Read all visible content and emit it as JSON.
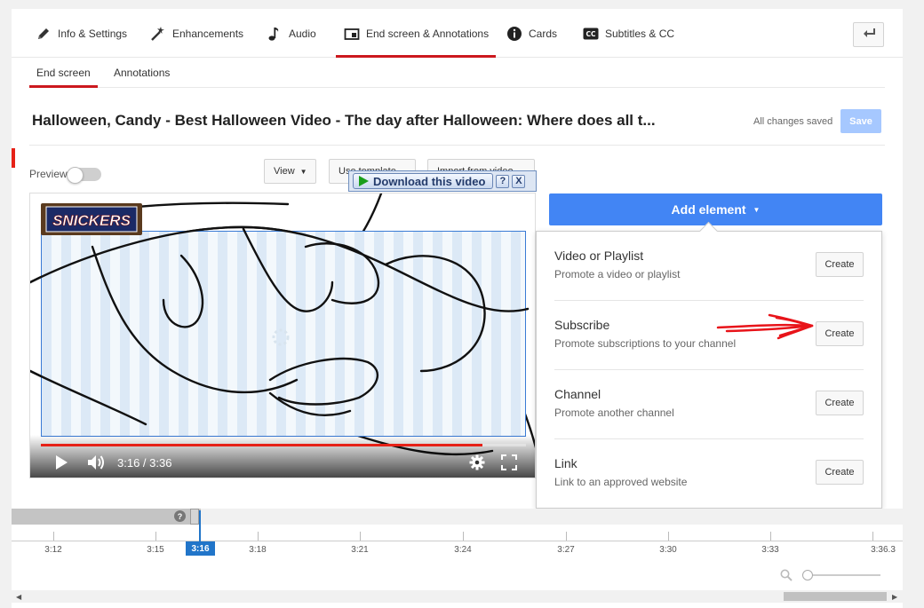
{
  "tabs": [
    {
      "label": "Info & Settings",
      "icon": "pencil-icon"
    },
    {
      "label": "Enhancements",
      "icon": "magic-wand-icon"
    },
    {
      "label": "Audio",
      "icon": "music-note-icon"
    },
    {
      "label": "End screen & Annotations",
      "icon": "end-screen-icon",
      "active": true
    },
    {
      "label": "Cards",
      "icon": "info-icon"
    },
    {
      "label": "Subtitles & CC",
      "icon": "cc-icon"
    }
  ],
  "subtabs": [
    {
      "label": "End screen",
      "active": true
    },
    {
      "label": "Annotations"
    }
  ],
  "header": {
    "title": "Halloween, Candy - Best Halloween Video - The day after Halloween: Where does all t...",
    "saved_status": "All changes saved",
    "save_label": "Save"
  },
  "toolbar": {
    "preview_label": "Preview",
    "view_label": "View",
    "use_template_label": "Use template",
    "import_label": "Import from video"
  },
  "overlay": {
    "download_label": "Download this video",
    "help": "?",
    "close": "X"
  },
  "video": {
    "logo_text": "SNICKERS",
    "current_time": "3:16",
    "duration": "3:36",
    "time_display": "3:16 / 3:36",
    "progress": 0.91
  },
  "add_element": {
    "label": "Add element",
    "options": [
      {
        "title": "Video or Playlist",
        "desc": "Promote a video or playlist",
        "button": "Create"
      },
      {
        "title": "Subscribe",
        "desc": "Promote subscriptions to your channel",
        "button": "Create"
      },
      {
        "title": "Channel",
        "desc": "Promote another channel",
        "button": "Create"
      },
      {
        "title": "Link",
        "desc": "Link to an approved website",
        "button": "Create"
      }
    ]
  },
  "timeline": {
    "help": "?",
    "playhead_label": "3:16",
    "ticks": [
      "3:12",
      "3:15",
      "3:18",
      "3:21",
      "3:24",
      "3:27",
      "3:30",
      "3:33",
      "3:36.3"
    ]
  },
  "colors": {
    "accent_red": "#cc181e",
    "add_button_blue": "#4285f4",
    "playhead_blue": "#2175c9",
    "save_disabled": "#a6c8ff"
  }
}
